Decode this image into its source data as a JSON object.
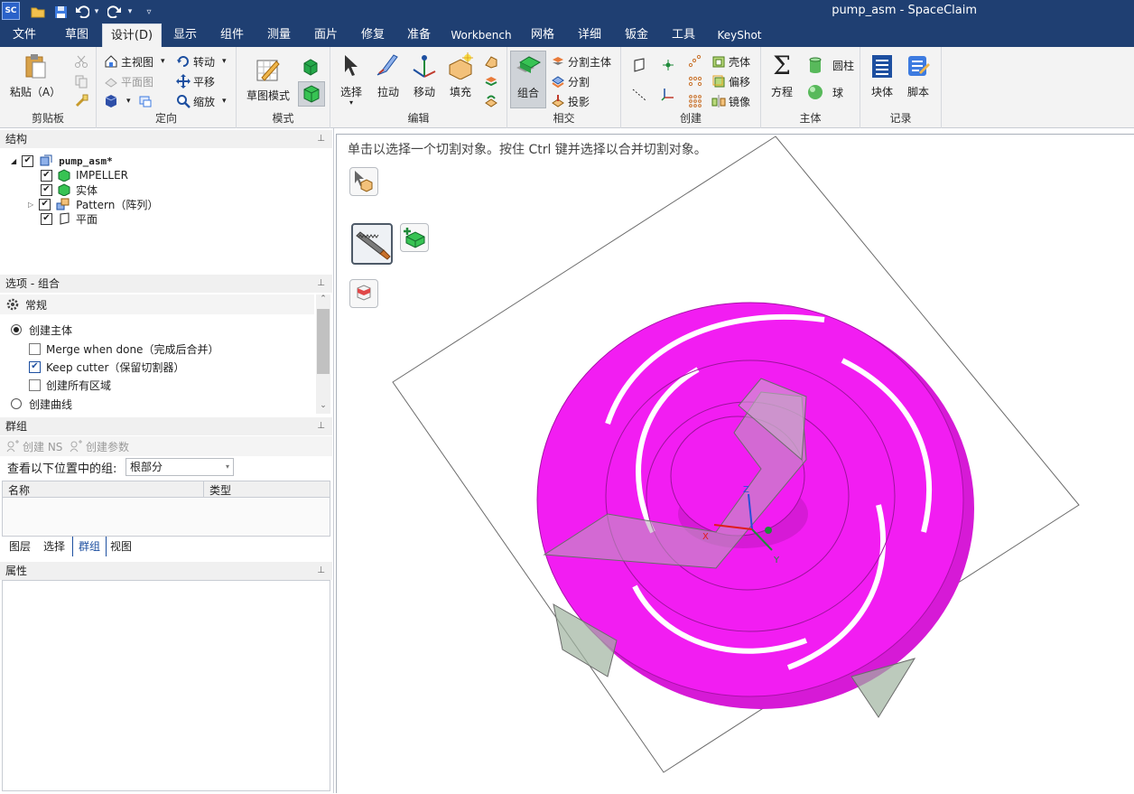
{
  "window": {
    "title": "pump_asm - SpaceClaim",
    "logo": "SC"
  },
  "quick_access": {
    "icons": [
      "open-icon",
      "save-icon",
      "undo-icon",
      "redo-icon",
      "customize-icon"
    ]
  },
  "menu": {
    "tabs": [
      "文件",
      "草图",
      "设计(D)",
      "显示",
      "组件",
      "测量",
      "面片",
      "修复",
      "准备",
      "Workbench",
      "网格",
      "详细",
      "钣金",
      "工具",
      "KeyShot"
    ],
    "active": "设计(D)"
  },
  "ribbon": {
    "clipboard": {
      "label": "剪贴板",
      "paste": "粘贴（A）"
    },
    "orient": {
      "label": "定向",
      "home_view": "主视图",
      "plan_view": "平面图",
      "rotate": "转动",
      "pan": "平移",
      "zoom": "缩放"
    },
    "mode": {
      "label": "模式",
      "sketch_mode": "草图模式"
    },
    "edit": {
      "label": "编辑",
      "select": "选择",
      "pull": "拉动",
      "move": "移动",
      "fill": "填充"
    },
    "intersect": {
      "label": "相交",
      "combine": "组合",
      "split_body": "分割主体",
      "split": "分割",
      "project": "投影"
    },
    "create": {
      "label": "创建",
      "shell": "壳体",
      "offset": "偏移",
      "mirror": "镜像"
    },
    "body": {
      "label": "主体",
      "equation": "方程",
      "cylinder": "圆柱",
      "sphere": "球"
    },
    "record": {
      "label": "记录",
      "block": "块体",
      "script": "脚本"
    }
  },
  "structure": {
    "title": "结构",
    "root": "pump_asm*",
    "items": [
      {
        "label": "IMPELLER",
        "icon": "solid-body-icon"
      },
      {
        "label": "实体",
        "icon": "solid-body-icon"
      },
      {
        "label": "Pattern（阵列）",
        "icon": "pattern-icon"
      },
      {
        "label": "平面",
        "icon": "plane-icon"
      }
    ]
  },
  "options": {
    "title": "选项 - 组合",
    "section": "常规",
    "create_body": "创建主体",
    "merge_when_done": "Merge when done（完成后合并）",
    "keep_cutter": "Keep cutter（保留切割器）",
    "create_all_regions": "创建所有区域",
    "create_curves": "创建曲线",
    "state": {
      "create_body": true,
      "merge_when_done": false,
      "keep_cutter": true,
      "create_all_regions": false,
      "create_curves": false
    }
  },
  "groups": {
    "title": "群组",
    "create_ns": "创建 NS",
    "create_param": "创建参数",
    "view_label": "查看以下位置中的组:",
    "view_value": "根部分",
    "columns": [
      "名称",
      "类型"
    ],
    "tabs": [
      "图层",
      "选择",
      "群组",
      "视图"
    ],
    "active_tab": "群组"
  },
  "properties": {
    "title": "属性"
  },
  "viewport": {
    "hint": "单击以选择一个切割对象。按住 Ctrl 键并选择以合并切割对象。",
    "colors": {
      "body": "#f21df2",
      "cutter": "#b9a7b9",
      "plane": "#6b6b6b"
    },
    "axes": {
      "x": "X",
      "y": "Y",
      "z": "Z"
    }
  }
}
